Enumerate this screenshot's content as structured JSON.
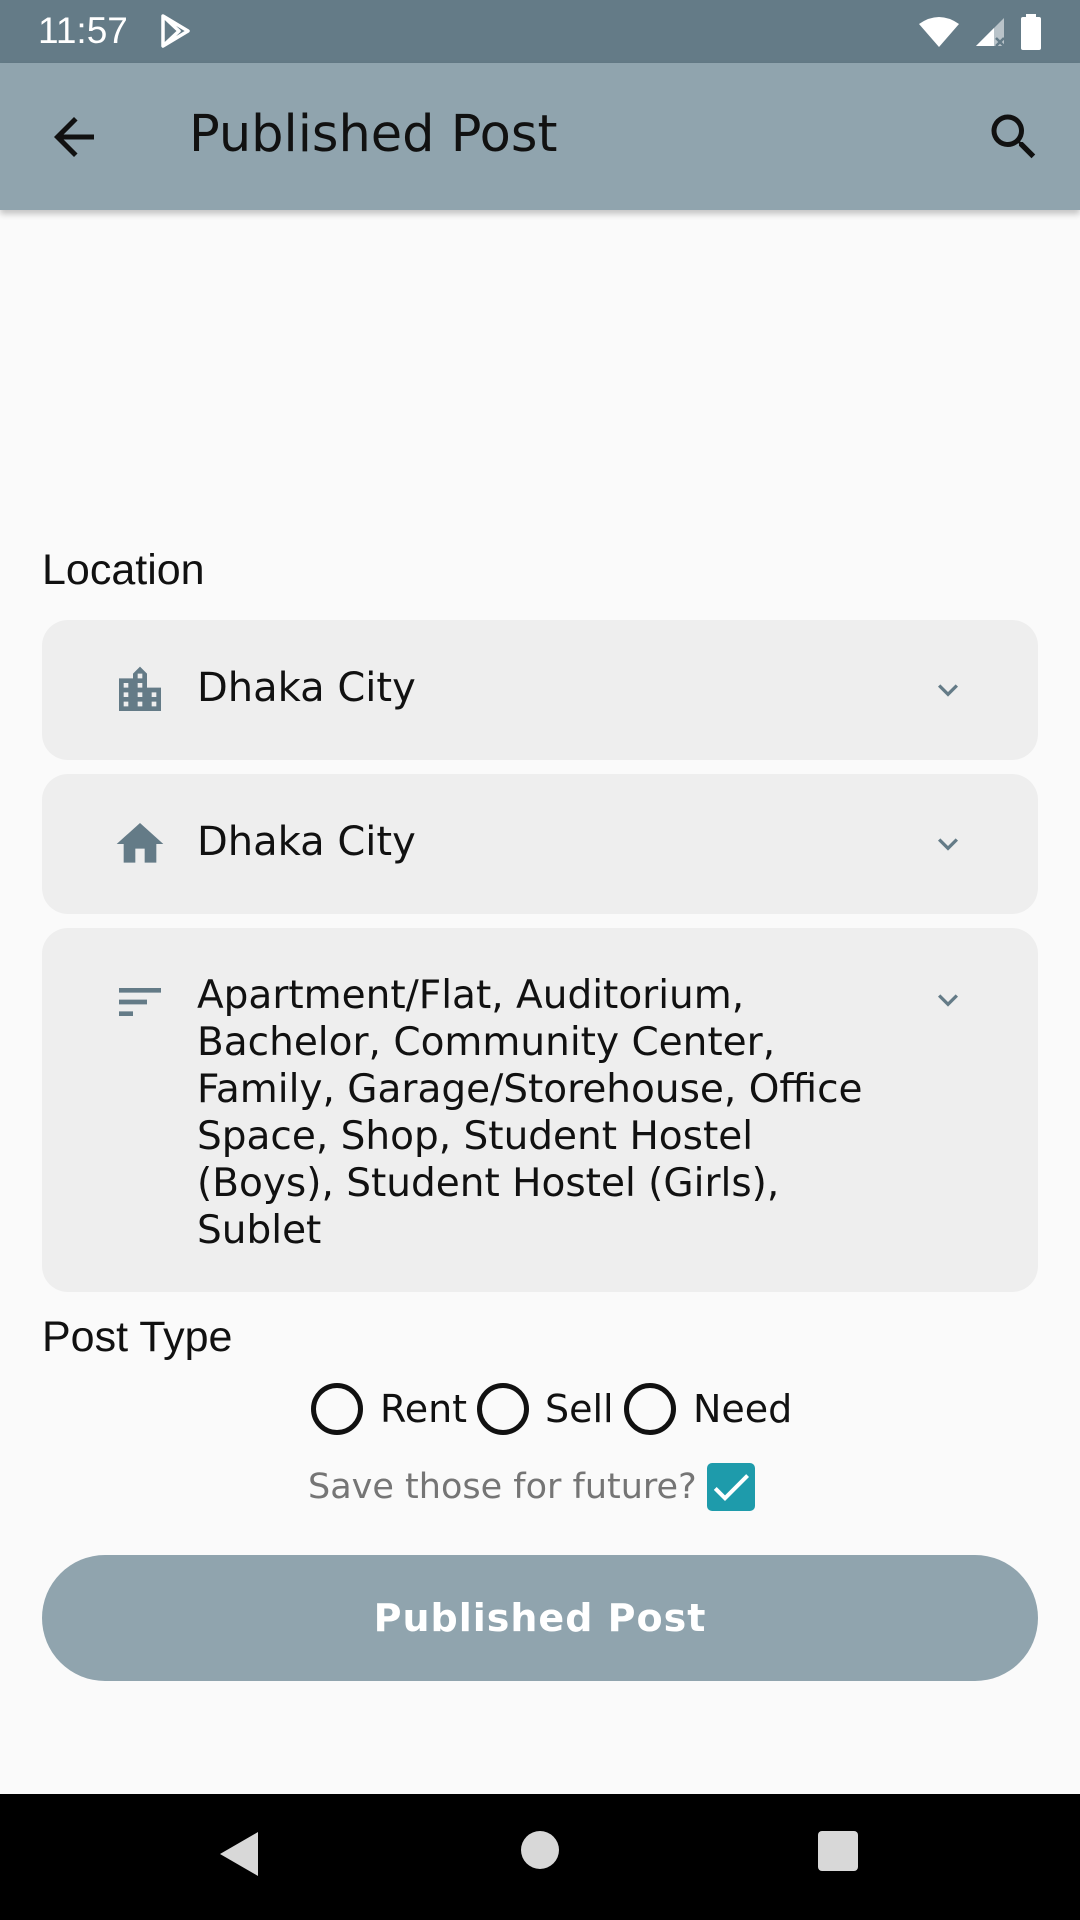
{
  "status_bar": {
    "time": "11:57"
  },
  "app_bar": {
    "title": "Published Post"
  },
  "location": {
    "label": "Location",
    "city_dropdown": {
      "value": "Dhaka City",
      "icon": "city-icon"
    },
    "area_dropdown": {
      "value": "Dhaka City",
      "icon": "home-icon"
    },
    "category_dropdown": {
      "value": "Apartment/Flat, Auditorium, Bachelor, Community Center, Family, Garage/Storehouse, Office Space, Shop, Student Hostel (Boys), Student Hostel (Girls), Sublet",
      "icon": "filter-list-icon"
    }
  },
  "post_type": {
    "label": "Post Type",
    "options": [
      {
        "label": "Rent",
        "selected": false
      },
      {
        "label": "Sell",
        "selected": false
      },
      {
        "label": "Need",
        "selected": false
      }
    ]
  },
  "save_future": {
    "label": "Save those for future?",
    "checked": true
  },
  "publish_button": {
    "label": "Published Post"
  },
  "colors": {
    "status_bar": "#647b87",
    "app_bar": "#90a4ae",
    "checkbox": "#1e9bab",
    "button": "#90a4ae"
  }
}
